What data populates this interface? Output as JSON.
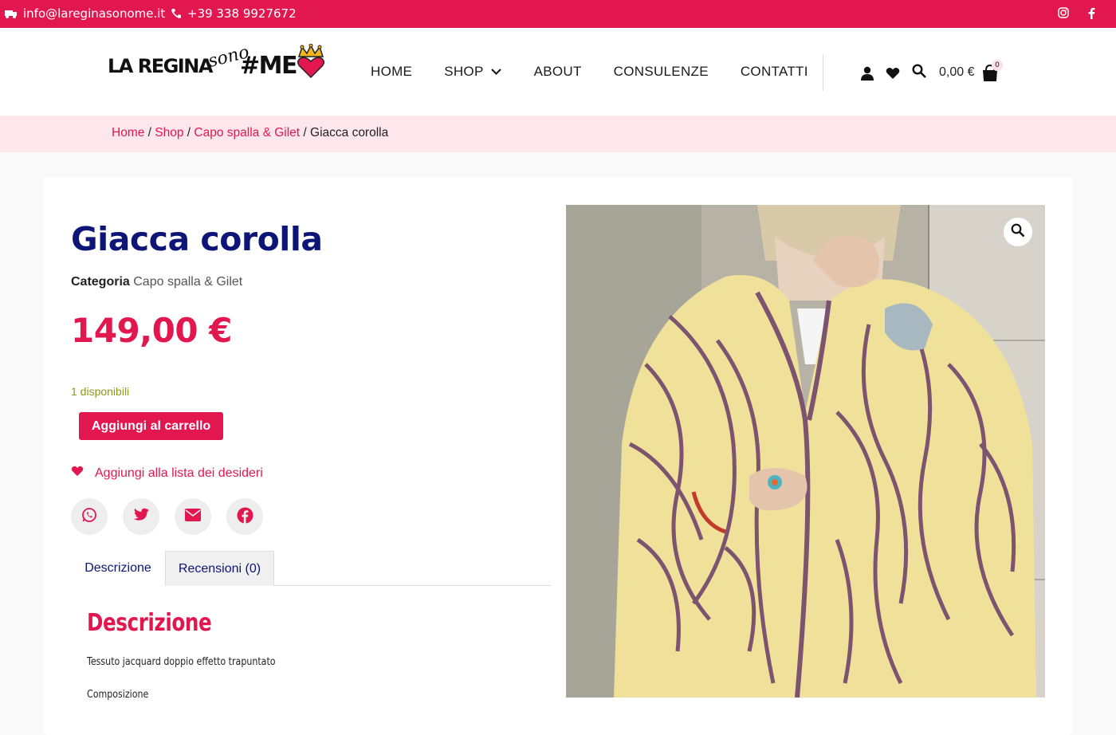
{
  "topbar": {
    "email": "info@lareginasonome.it",
    "phone": "+39 338 9927672",
    "email_icon": "truck-mail-icon",
    "phone_icon": "phone-icon",
    "social": [
      "instagram-icon",
      "facebook-icon"
    ]
  },
  "logo": {
    "part1": "LA REGINA",
    "part2": "sono",
    "part3": "#ME"
  },
  "nav": {
    "items": [
      {
        "label": "HOME"
      },
      {
        "label": "SHOP"
      },
      {
        "label": "ABOUT"
      },
      {
        "label": "CONSULENZE"
      },
      {
        "label": "CONTATTI"
      }
    ]
  },
  "header_tools": {
    "cart_total": "0,00 €",
    "cart_count": "0"
  },
  "breadcrumb": {
    "home": "Home",
    "sep": " / ",
    "shop": "Shop",
    "category": "Capo spalla & Gilet",
    "current": "Giacca corolla"
  },
  "product": {
    "title": "Giacca corolla",
    "category_label": "Categoria",
    "category_value": "Capo spalla & Gilet",
    "price": "149,00 €",
    "stock": "1 disponibili",
    "add_to_cart": "Aggiungi al carrello",
    "wishlist": "Aggiungi alla lista dei desideri",
    "share": [
      "whatsapp-icon",
      "twitter-icon",
      "email-icon",
      "facebook-icon"
    ]
  },
  "tabs": [
    {
      "label": "Descrizione"
    },
    {
      "label": "Recensioni (0)"
    }
  ],
  "description": {
    "heading": "Descrizione",
    "line1": "Tessuto jacquard doppio effetto trapuntato",
    "line2": "Composizione"
  },
  "colors": {
    "accent": "#e3174f",
    "title": "#0d1577",
    "breadcrumb_bg": "#fde6ec",
    "stock": "#8a9a1a"
  }
}
